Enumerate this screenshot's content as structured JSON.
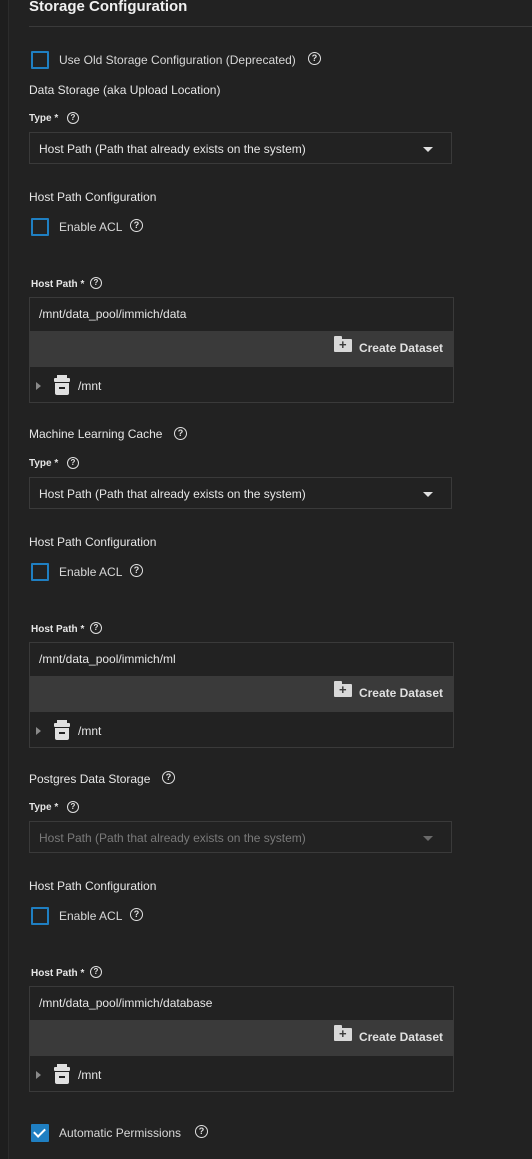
{
  "header": {
    "title": "Storage Configuration"
  },
  "use_old": {
    "label": "Use Old Storage Configuration (Deprecated)",
    "checked": false
  },
  "sections": [
    {
      "heading": "Data Storage (aka Upload Location)",
      "type_label": "Type *",
      "type_value": "Host Path (Path that already exists on the system)",
      "type_disabled": false,
      "host_path_config_label": "Host Path Configuration",
      "acl_label": "Enable ACL",
      "acl_checked": false,
      "host_path_label": "Host Path *",
      "host_path_value": "/mnt/data_pool/immich/data",
      "create_dataset_label": "Create Dataset",
      "tree_root": "/mnt"
    },
    {
      "heading": "Machine Learning Cache",
      "type_label": "Type *",
      "type_value": "Host Path (Path that already exists on the system)",
      "type_disabled": false,
      "host_path_config_label": "Host Path Configuration",
      "acl_label": "Enable ACL",
      "acl_checked": false,
      "host_path_label": "Host Path *",
      "host_path_value": "/mnt/data_pool/immich/ml",
      "create_dataset_label": "Create Dataset",
      "tree_root": "/mnt"
    },
    {
      "heading": "Postgres Data Storage",
      "type_label": "Type *",
      "type_value": "Host Path (Path that already exists on the system)",
      "type_disabled": true,
      "host_path_config_label": "Host Path Configuration",
      "acl_label": "Enable ACL",
      "acl_checked": false,
      "host_path_label": "Host Path *",
      "host_path_value": "/mnt/data_pool/immich/database",
      "create_dataset_label": "Create Dataset",
      "tree_root": "/mnt"
    }
  ],
  "automatic_permissions": {
    "label": "Automatic Permissions",
    "checked": true
  },
  "colors": {
    "accent": "#1f7fc2",
    "background": "#222222",
    "bar": "#3a3a3a"
  },
  "icons": {
    "help": "help-circle-icon",
    "create": "folder-plus-icon",
    "tree": "dataset-icon",
    "caret": "chevron-down-icon"
  }
}
